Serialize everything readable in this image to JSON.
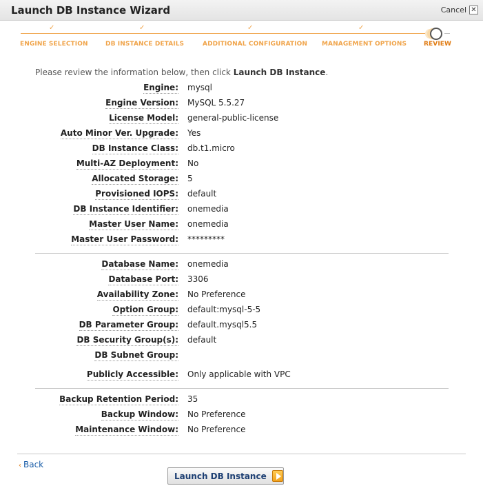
{
  "header": {
    "title": "Launch DB Instance Wizard",
    "cancel_label": "Cancel",
    "close_glyph": "✕"
  },
  "steps": [
    {
      "label": "ENGINE SELECTION",
      "state": "done"
    },
    {
      "label": "DB INSTANCE DETAILS",
      "state": "done"
    },
    {
      "label": "ADDITIONAL CONFIGURATION",
      "state": "done"
    },
    {
      "label": "MANAGEMENT OPTIONS",
      "state": "done"
    },
    {
      "label": "REVIEW",
      "state": "current"
    }
  ],
  "intro": {
    "prefix": "Please review the information below, then click ",
    "action": "Launch DB Instance",
    "suffix": "."
  },
  "sections": [
    [
      {
        "label": "Engine:",
        "value": "mysql"
      },
      {
        "label": "Engine Version:",
        "value": "MySQL 5.5.27"
      },
      {
        "label": "License Model:",
        "value": "general-public-license"
      },
      {
        "label": "Auto Minor Ver. Upgrade:",
        "value": "Yes"
      },
      {
        "label": "DB Instance Class:",
        "value": "db.t1.micro"
      },
      {
        "label": "Multi-AZ Deployment:",
        "value": "No"
      },
      {
        "label": "Allocated Storage:",
        "value": "5"
      },
      {
        "label": "Provisioned IOPS:",
        "value": "default"
      },
      {
        "label": "DB Instance Identifier:",
        "value": "onemedia"
      },
      {
        "label": "Master User Name:",
        "value": "onemedia"
      },
      {
        "label": "Master User Password:",
        "value": "*********"
      }
    ],
    [
      {
        "label": "Database Name:",
        "value": "onemedia"
      },
      {
        "label": "Database Port:",
        "value": "3306"
      },
      {
        "label": "Availability Zone:",
        "value": "No Preference"
      },
      {
        "label": "Option Group:",
        "value": "default:mysql-5-5"
      },
      {
        "label": "DB Parameter Group:",
        "value": "default.mysql5.5"
      },
      {
        "label": "DB Security Group(s):",
        "value": "default"
      },
      {
        "label": "DB Subnet Group:",
        "value": ""
      },
      {
        "label": "Publicly Accessible:",
        "value": "Only applicable with VPC"
      }
    ],
    [
      {
        "label": "Backup Retention Period:",
        "value": "35"
      },
      {
        "label": "Backup Window:",
        "value": "No Preference"
      },
      {
        "label": "Maintenance Window:",
        "value": "No Preference"
      }
    ]
  ],
  "footer": {
    "back_label": "Back",
    "back_glyph": "‹",
    "launch_label": "Launch DB Instance"
  },
  "colors": {
    "accent": "#f0a44a",
    "link": "#1a5da8",
    "button_text": "#1d3f73"
  }
}
